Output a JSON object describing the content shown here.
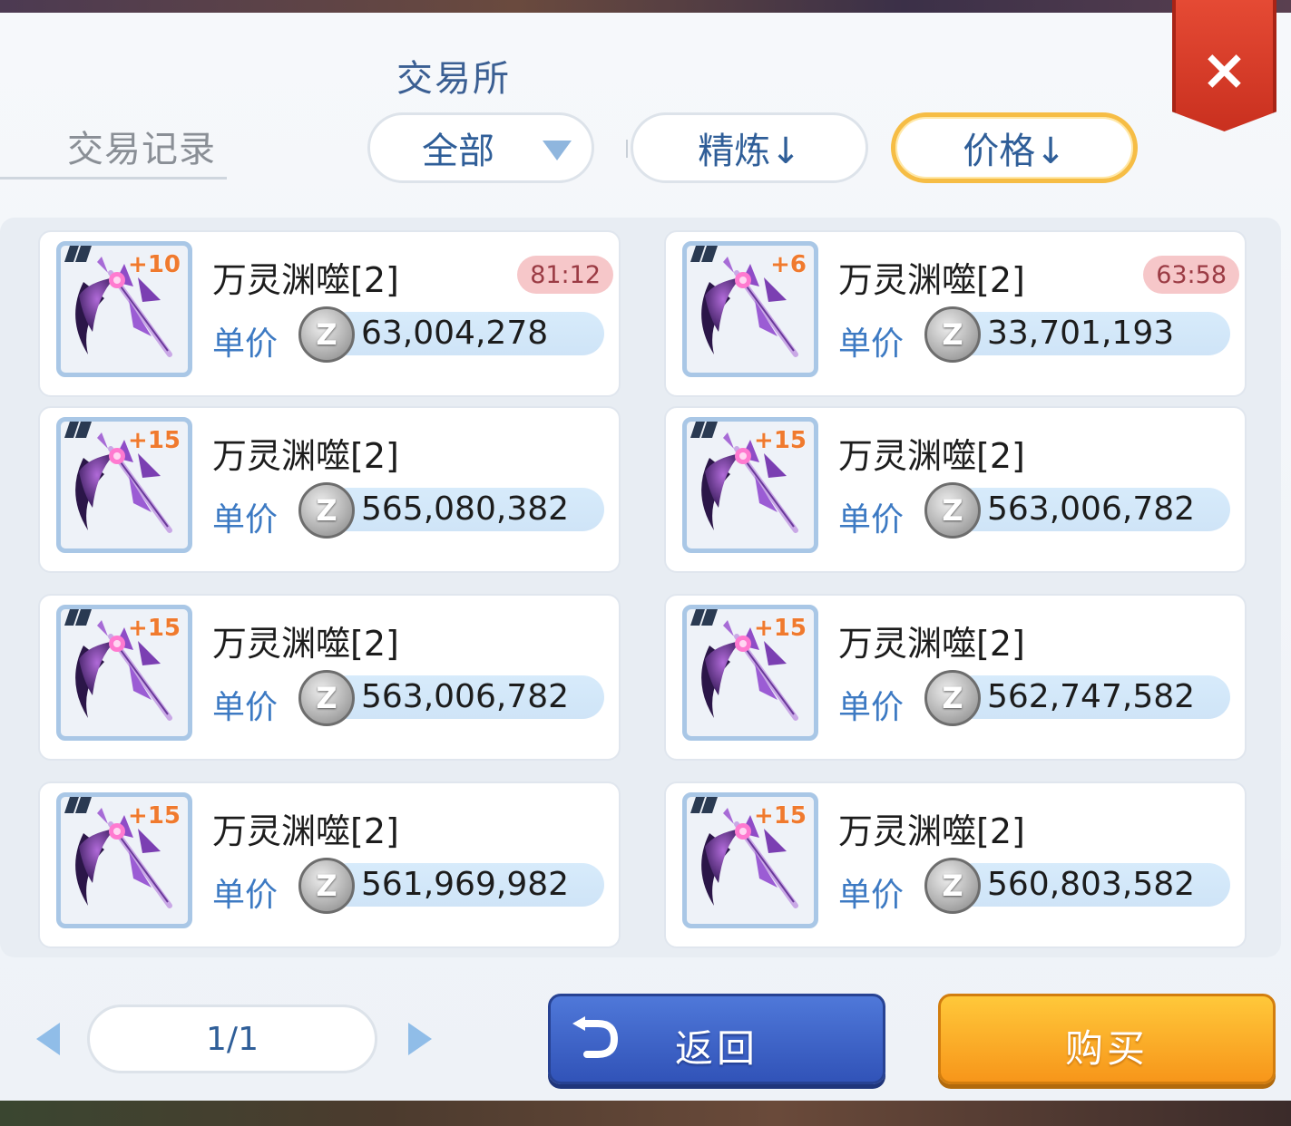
{
  "window": {
    "title": "交易所",
    "record_tab": "交易记录",
    "close_label": "×"
  },
  "filters": {
    "category": "全部",
    "refine_sort": "精炼↓",
    "price_sort": "价格↓",
    "active": "price"
  },
  "price_label": "单价",
  "currency_symbol": "Z",
  "items": [
    {
      "name": "万灵渊噬[2]",
      "refine": "+10",
      "timer": "81:12",
      "price": "63,004,278"
    },
    {
      "name": "万灵渊噬[2]",
      "refine": "+6",
      "timer": "63:58",
      "price": "33,701,193"
    },
    {
      "name": "万灵渊噬[2]",
      "refine": "+15",
      "timer": "",
      "price": "565,080,382"
    },
    {
      "name": "万灵渊噬[2]",
      "refine": "+15",
      "timer": "",
      "price": "563,006,782"
    },
    {
      "name": "万灵渊噬[2]",
      "refine": "+15",
      "timer": "",
      "price": "563,006,782"
    },
    {
      "name": "万灵渊噬[2]",
      "refine": "+15",
      "timer": "",
      "price": "562,747,582"
    },
    {
      "name": "万灵渊噬[2]",
      "refine": "+15",
      "timer": "",
      "price": "561,969,982"
    },
    {
      "name": "万灵渊噬[2]",
      "refine": "+15",
      "timer": "",
      "price": "560,803,582"
    }
  ],
  "pagination": {
    "page": "1/1"
  },
  "buttons": {
    "back": "返回",
    "buy": "购买"
  },
  "colors": {
    "accent_blue": "#2f5e98",
    "active_border": "#f6bd45",
    "timer_bg": "#f6c7c9",
    "close_red": "#d8382a",
    "buy_orange": "#f7a821",
    "back_blue": "#3f63c8"
  }
}
